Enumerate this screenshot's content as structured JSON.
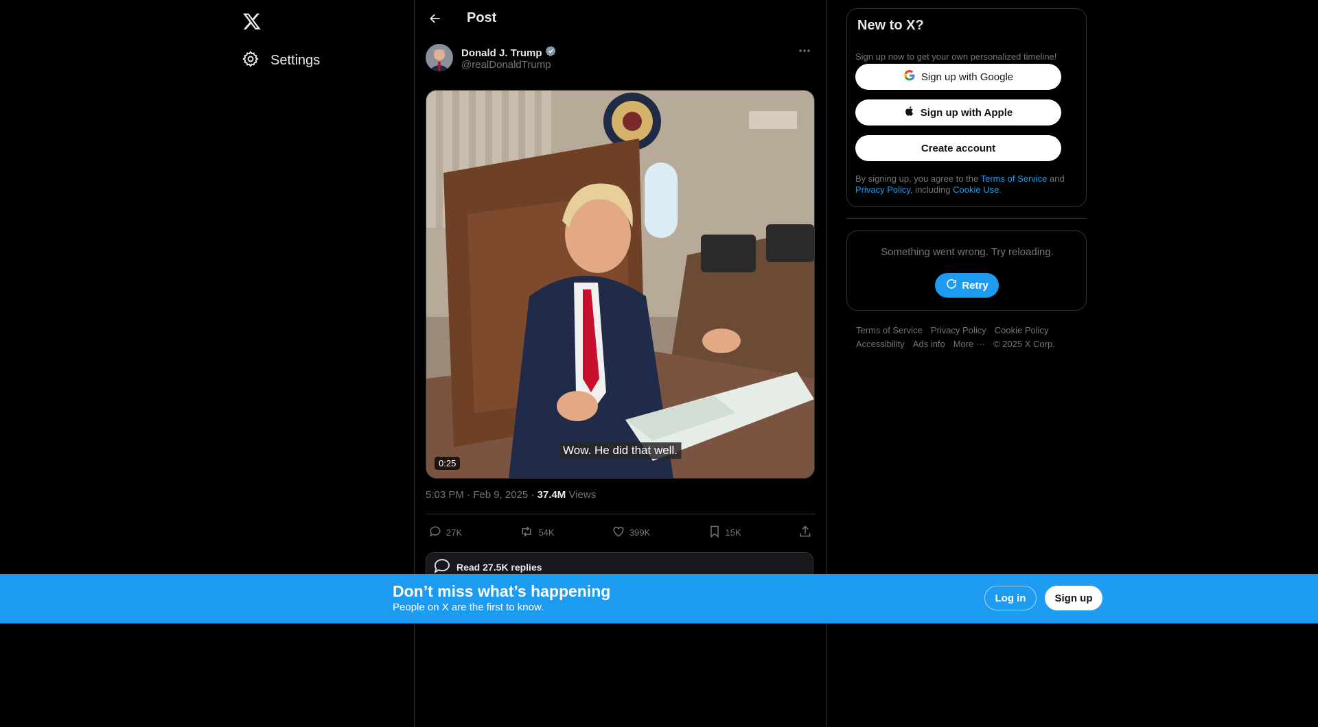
{
  "nav": {
    "settings_label": "Settings"
  },
  "header": {
    "title": "Post"
  },
  "post": {
    "author_name": "Donald J. Trump",
    "author_handle": "@realDonaldTrump",
    "video_duration": "0:25",
    "video_caption": "Wow. He did that well.",
    "time_date": "5:03 PM · Feb 9, 2025 · ",
    "views_count": "37.4M",
    "views_label": " Views",
    "replies": "27K",
    "reposts": "54K",
    "likes": "399K",
    "bookmarks": "15K",
    "read_replies": "Read 27.5K replies"
  },
  "signup": {
    "title": "New to X?",
    "subtitle": "Sign up now to get your own personalized timeline!",
    "google": "Sign up with Google",
    "apple": "Sign up with Apple",
    "create": "Create account",
    "legal_prefix": "By signing up, you agree to the ",
    "terms": "Terms of Service",
    "and": " and",
    "privacy": "Privacy Policy",
    "including": ", including ",
    "cookie": "Cookie Use",
    "period": "."
  },
  "error": {
    "message": "Something went wrong. Try reloading.",
    "retry": "Retry"
  },
  "footer": {
    "terms": "Terms of Service",
    "privacy": "Privacy Policy",
    "cookie": "Cookie Policy",
    "accessibility": "Accessibility",
    "ads": "Ads info",
    "more": "More ···",
    "copyright": "© 2025 X Corp."
  },
  "banner": {
    "headline": "Don’t miss what’s happening",
    "sub": "People on X are the first to know.",
    "login": "Log in",
    "signup": "Sign up"
  },
  "colors": {
    "accent": "#1d9bf0",
    "background": "#000000",
    "muted": "#71767b"
  }
}
